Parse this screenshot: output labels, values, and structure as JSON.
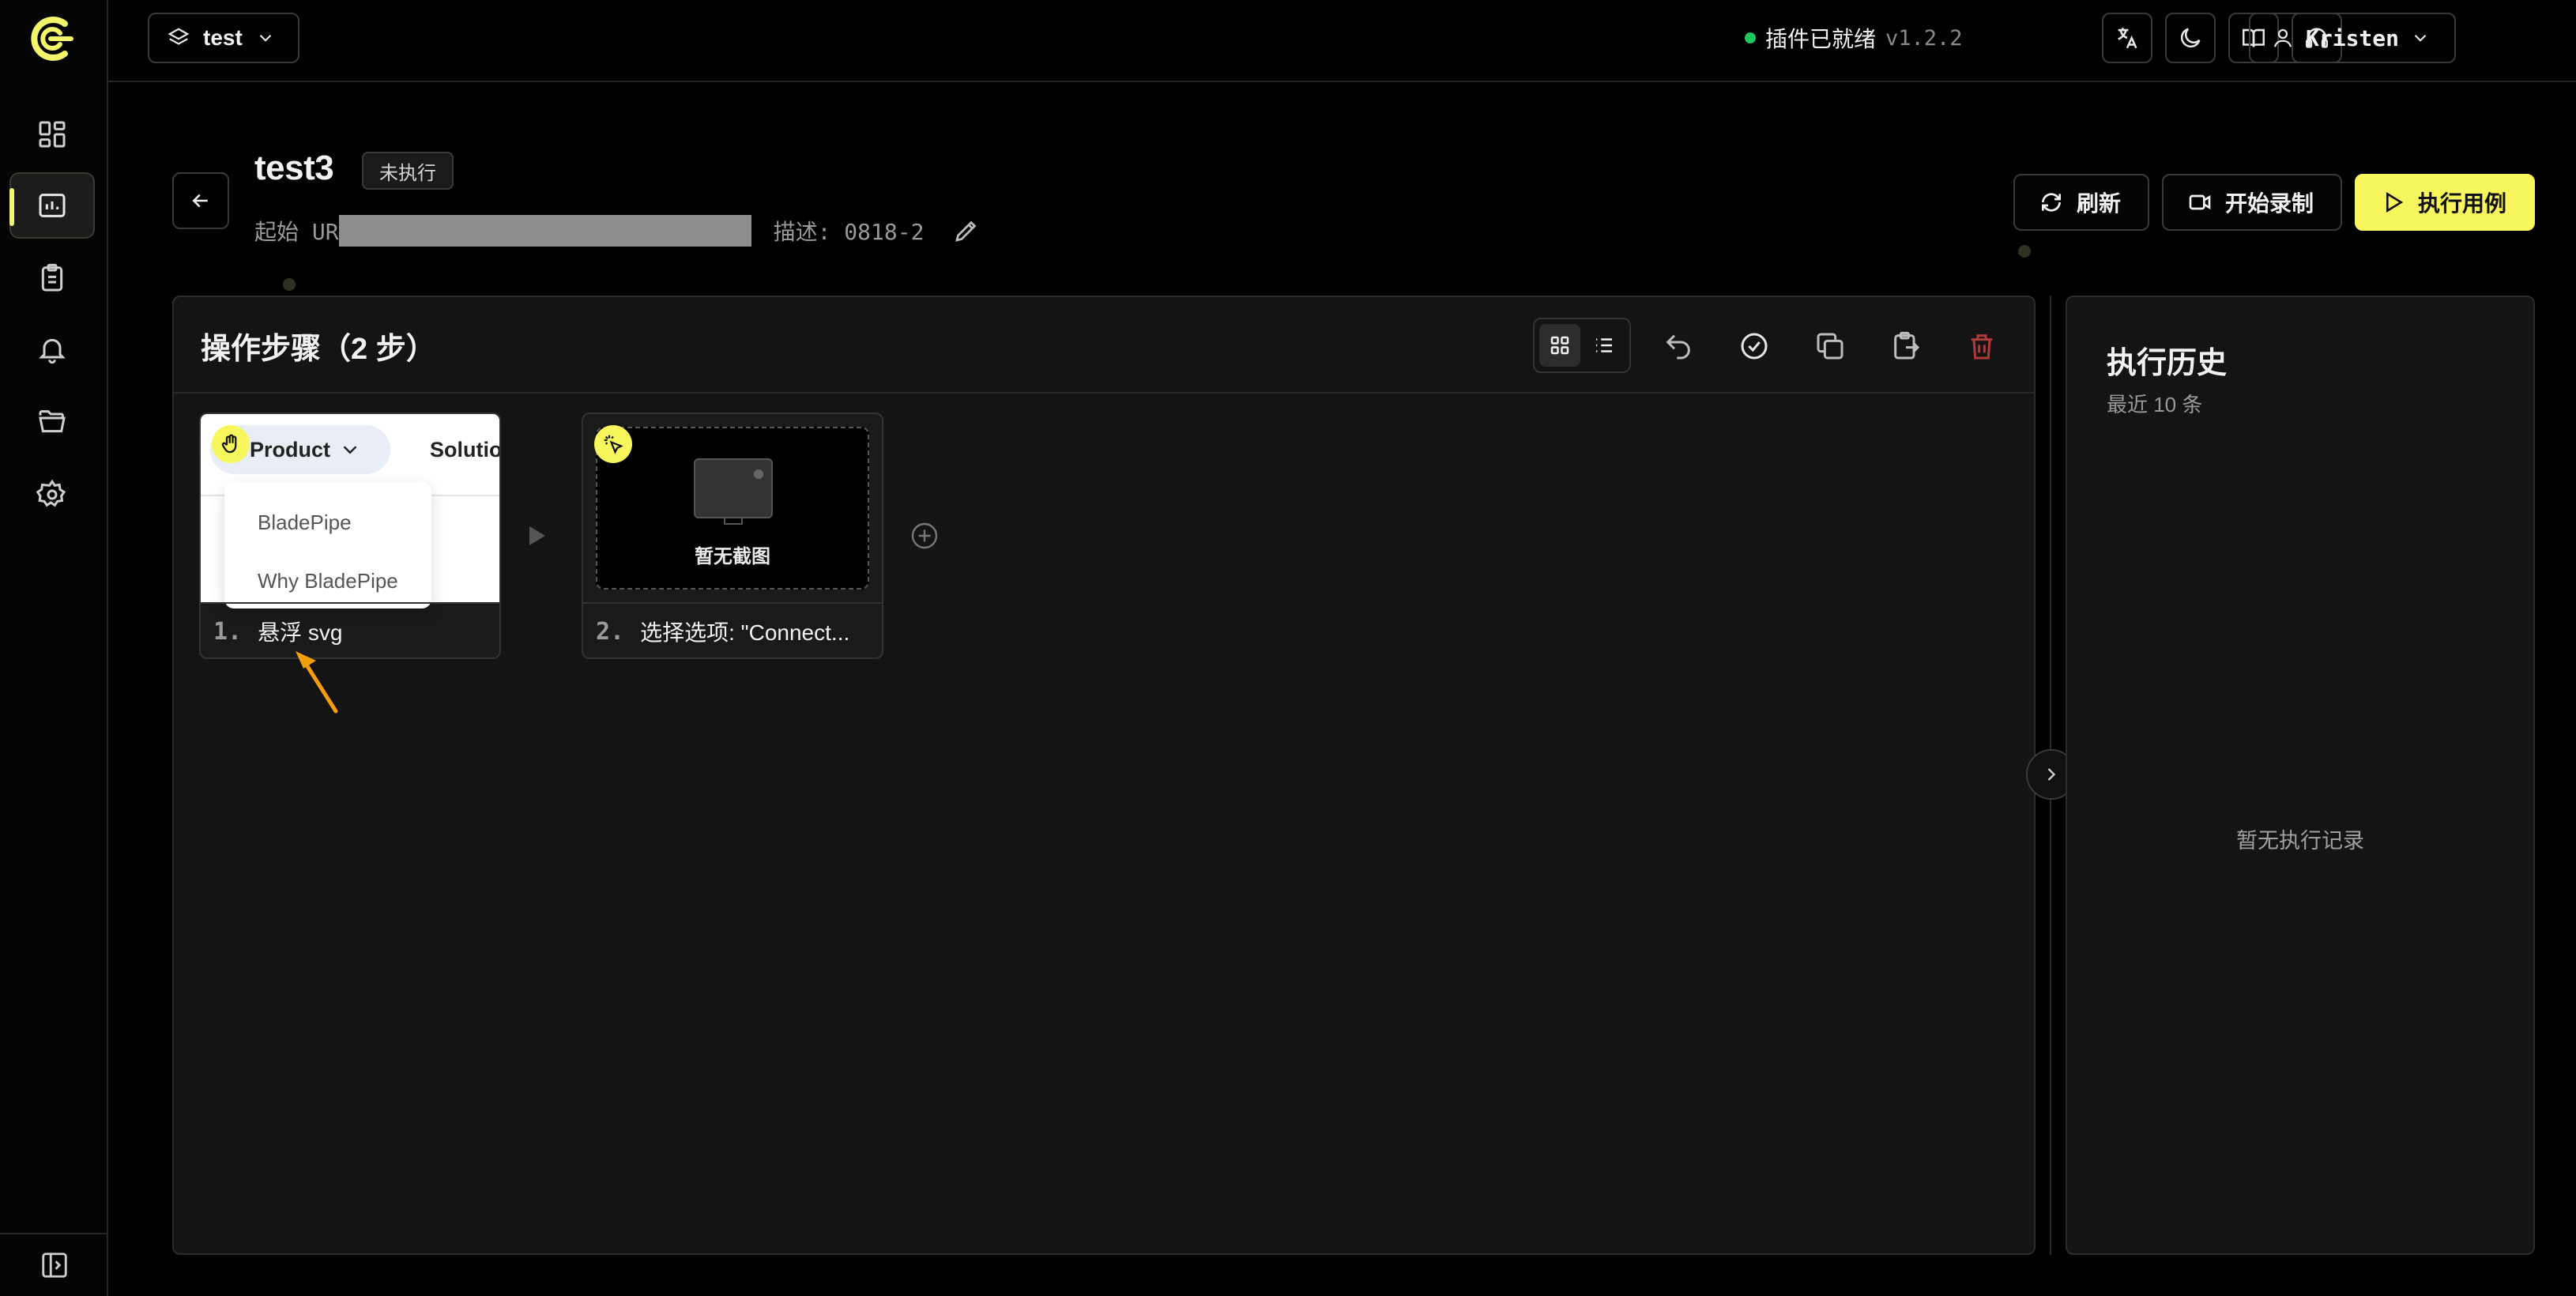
{
  "topbar": {
    "project": "test",
    "status_text": "插件已就绪",
    "version": "v1.2.2",
    "user": "Kristen"
  },
  "sidebar": {
    "items": [
      {
        "icon": "dashboard-icon"
      },
      {
        "icon": "test-cases-icon",
        "active": true
      },
      {
        "icon": "clipboard-icon"
      },
      {
        "icon": "bell-icon"
      },
      {
        "icon": "folder-icon"
      },
      {
        "icon": "gear-icon"
      }
    ]
  },
  "case": {
    "title": "test3",
    "badge": "未执行",
    "url_label": "起始 UR",
    "desc": "描述: 0818-2"
  },
  "actions": {
    "refresh": "刷新",
    "record": "开始录制",
    "run": "执行用例"
  },
  "steps": {
    "title": "操作步骤（2 步）",
    "items": [
      {
        "num": "1.",
        "label": "悬浮 svg",
        "preview": {
          "pill": "Product",
          "solution": "Solutio",
          "menu": [
            "BladePipe",
            "Why BladePipe"
          ]
        }
      },
      {
        "num": "2.",
        "label": "选择选项: \"Connect...",
        "preview": {
          "empty": "暂无截图"
        }
      }
    ]
  },
  "history": {
    "title": "执行历史",
    "subtitle": "最近 10 条",
    "empty": "暂无执行记录"
  },
  "colors": {
    "accent": "#f7f65d",
    "status_ok": "#22c55e",
    "danger": "#b13a3a"
  }
}
